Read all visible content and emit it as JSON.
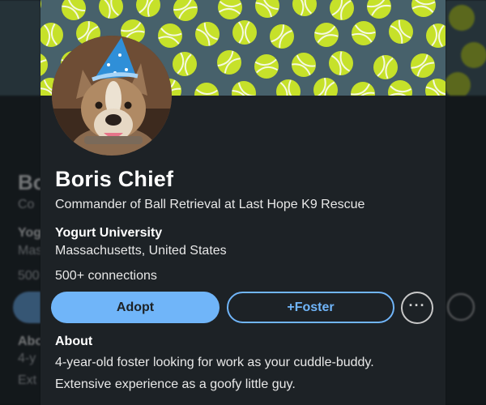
{
  "profile": {
    "name": "Boris Chief",
    "headline": "Commander of Ball Retrieval at Last Hope K9 Rescue",
    "education": "Yogurt University",
    "location": "Massachusetts, United States",
    "connections": "500+ connections"
  },
  "actions": {
    "adopt_label": "Adopt",
    "foster_label": "+Foster",
    "more_label": "···"
  },
  "about": {
    "title": "About",
    "line1": "4-year-old foster looking for work as your cuddle-buddy.",
    "line2": "Extensive experience as a goofy little guy."
  },
  "ghost_left": {
    "name_frag": "Bo",
    "headline_frag": "Co",
    "edu_frag": "Yog",
    "loc_frag": "Mas",
    "conn_frag": "500",
    "about_frag": "Abo",
    "line1_frag": "4-y",
    "line2_frag": "Ext"
  },
  "colors": {
    "accent": "#70b5f9",
    "card_bg": "#1d2226",
    "banner_bg": "#47616b",
    "ball": "#c6e12a"
  },
  "icons": {
    "more": "ellipsis-icon",
    "banner": "tennis-ball-pattern",
    "avatar": "dog-party-hat-photo"
  }
}
